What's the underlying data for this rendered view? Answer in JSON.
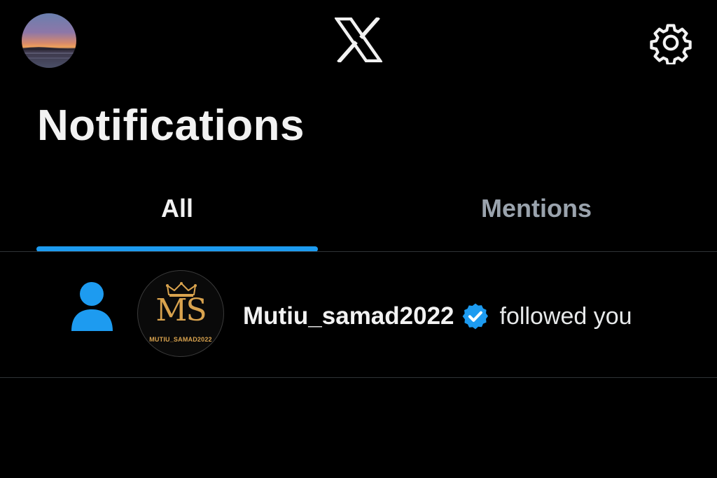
{
  "header": {
    "logo_icon": "x-logo-icon",
    "settings_icon": "gear-icon",
    "profile_avatar": "sunset-photo-avatar"
  },
  "page": {
    "title": "Notifications"
  },
  "tabs": [
    {
      "label": "All",
      "selected": true
    },
    {
      "label": "Mentions",
      "selected": false
    }
  ],
  "notifications": [
    {
      "type_icon": "person-icon",
      "avatar_monogram": "MS",
      "avatar_caption": "MUTIU_SAMAD2022",
      "username": "Mutiu_samad2022",
      "verified": true,
      "action": "followed you"
    }
  ],
  "colors": {
    "accent": "#1d9bf0",
    "background": "#000000",
    "text_primary": "#e7e9ea",
    "text_secondary": "#9aa3ad",
    "divider": "#2f3336",
    "avatar_gold": "#d9a34e"
  }
}
